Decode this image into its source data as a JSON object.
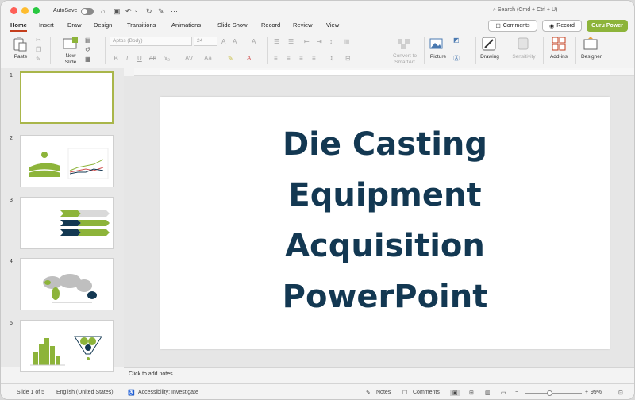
{
  "titlebar": {
    "autosave_label": "AutoSave",
    "search_placeholder": "Search (Cmd + Ctrl + U)"
  },
  "tabs": [
    "Home",
    "Insert",
    "Draw",
    "Design",
    "Transitions",
    "Animations",
    "Slide Show",
    "Record",
    "Review",
    "View"
  ],
  "header_buttons": {
    "comments": "Comments",
    "record": "Record",
    "guru": "Guru Power"
  },
  "ribbon": {
    "paste": "Paste",
    "new_slide": "New\nSlide",
    "font_name": "Aptos (Body)",
    "font_size": "24",
    "convert_smartart": "Convert to\nSmartArt",
    "picture": "Picture",
    "drawing": "Drawing",
    "sensitivity": "Sensitivity",
    "addins": "Add-ins",
    "designer": "Designer"
  },
  "slide": {
    "title_lines": [
      "Die Casting",
      "Equipment",
      "Acquisition",
      "PowerPoint"
    ]
  },
  "thumbnails": [
    {
      "num": "1"
    },
    {
      "num": "2"
    },
    {
      "num": "3"
    },
    {
      "num": "4"
    },
    {
      "num": "5"
    }
  ],
  "notes_placeholder": "Click to add notes",
  "status": {
    "slide_of": "Slide 1 of 5",
    "language": "English (United States)",
    "accessibility": "Accessibility: Investigate",
    "notes": "Notes",
    "comments": "Comments",
    "zoom": "99%"
  },
  "colors": {
    "title_text": "#133852",
    "accent_green": "#8db43a",
    "tab_underline": "#c43e1c"
  }
}
